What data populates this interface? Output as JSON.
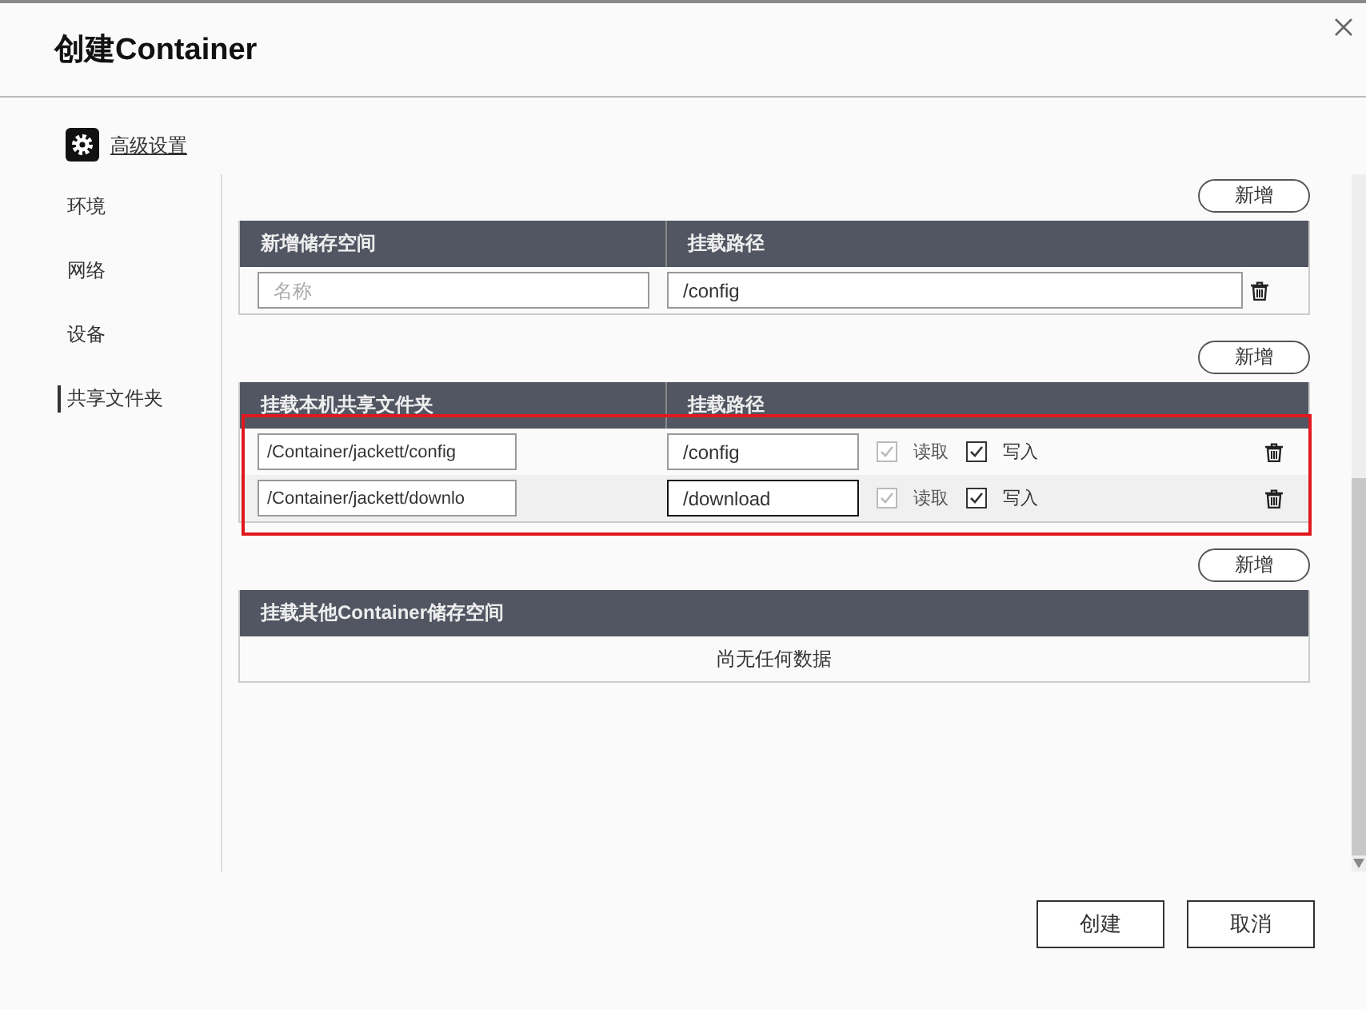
{
  "dialog": {
    "title": "创建Container"
  },
  "advanced_link": "高级设置",
  "sidebar": {
    "items": [
      {
        "label": "环境",
        "selected": false
      },
      {
        "label": "网络",
        "selected": false
      },
      {
        "label": "设备",
        "selected": false
      },
      {
        "label": "共享文件夹",
        "selected": true
      }
    ]
  },
  "sections": [
    {
      "kind": "storage",
      "add_button": "新增",
      "columns": [
        "新增储存空间",
        "挂载路径"
      ],
      "highlighted": false,
      "rows": [
        {
          "source": {
            "placeholder": "名称"
          },
          "mount": "/config",
          "focused": false
        }
      ]
    },
    {
      "kind": "shared",
      "add_button": "新增",
      "columns": [
        "挂载本机共享文件夹",
        "挂载路径"
      ],
      "highlighted": true,
      "rows": [
        {
          "source": {
            "value": "/Container/jackett/config"
          },
          "mount": "/config",
          "focused": false,
          "read": {
            "label": "读取",
            "checked": true,
            "disabled": true
          },
          "write": {
            "label": "写入",
            "checked": true,
            "disabled": false
          }
        },
        {
          "source": {
            "value": "/Container/jackett/downlo"
          },
          "mount": "/download",
          "focused": true,
          "read": {
            "label": "读取",
            "checked": true,
            "disabled": true
          },
          "write": {
            "label": "写入",
            "checked": true,
            "disabled": false
          }
        }
      ]
    },
    {
      "kind": "container",
      "add_button": "新增",
      "columns": [
        "挂载其他Container储存空间"
      ],
      "highlighted": false,
      "empty_text": "尚无任何数据"
    }
  ],
  "buttons": [
    {
      "label": "创建"
    },
    {
      "label": "取消"
    }
  ]
}
